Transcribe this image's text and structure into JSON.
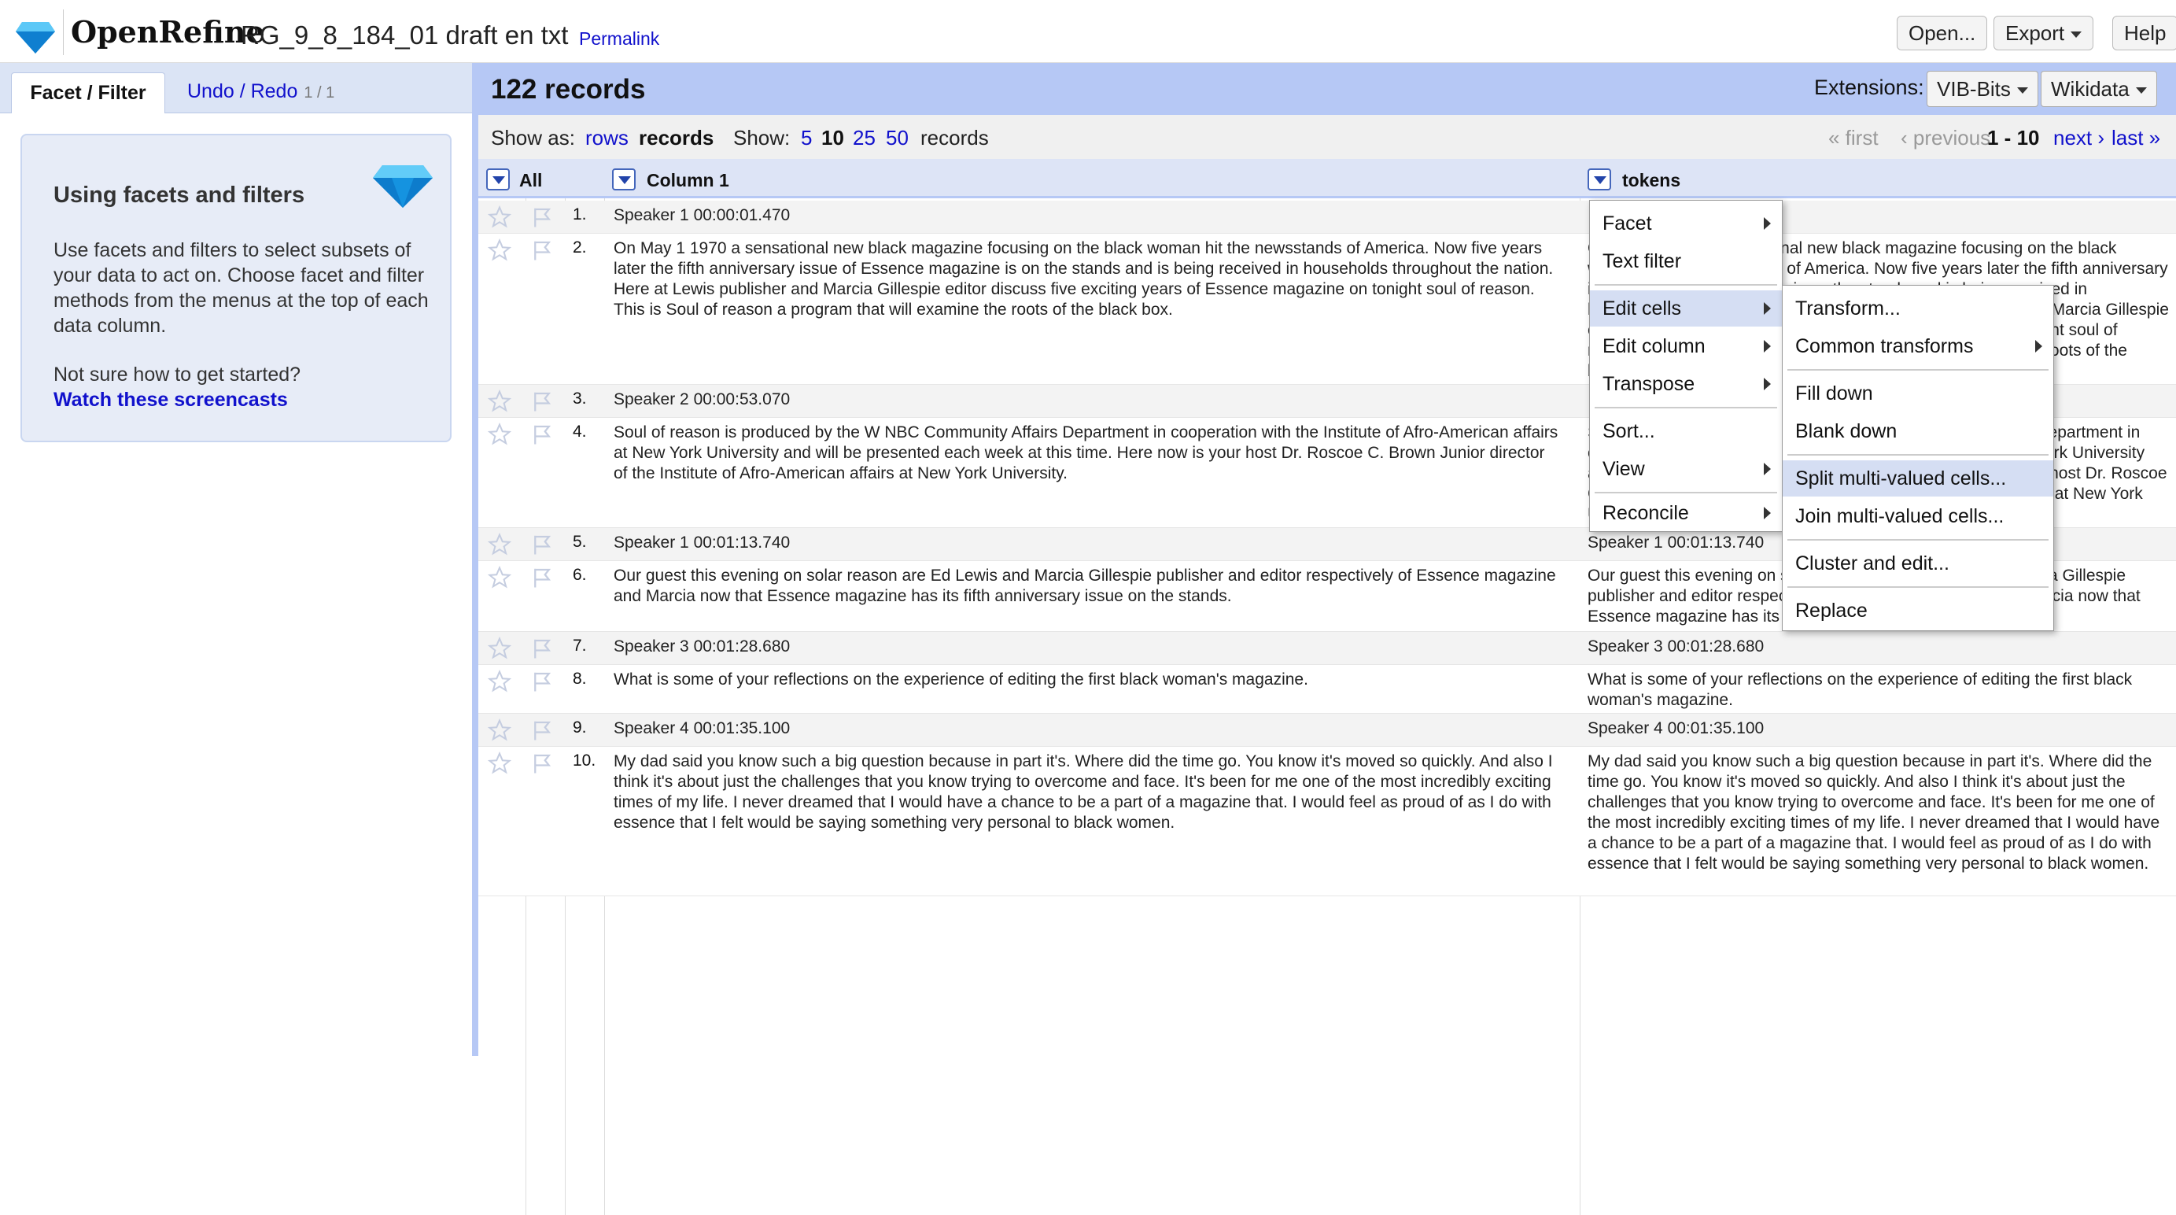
{
  "header": {
    "app_name": "OpenRefine",
    "project_name": "RG_9_8_184_01 draft en txt",
    "permalink": "Permalink",
    "open_label": "Open...",
    "export_label": "Export",
    "help_label": "Help"
  },
  "left_panel": {
    "tab_facet": "Facet / Filter",
    "tab_undo": "Undo / Redo",
    "tab_undo_count": "1 / 1",
    "help_title": "Using facets and filters",
    "help_body": "Use facets and filters to select subsets of your data to act on. Choose facet and filter methods from the menus at the top of each data column.",
    "help_started": "Not sure how to get started?",
    "help_link": "Watch these screencasts"
  },
  "summary": {
    "record_count": "122 records",
    "extensions_label": "Extensions:",
    "ext_vib": "VIB-Bits",
    "ext_wikidata": "Wikidata"
  },
  "view_bar": {
    "show_as": "Show as:",
    "rows": "rows",
    "records": "records",
    "show": "Show:",
    "sizes": [
      "5",
      "10",
      "25",
      "50"
    ],
    "records_suffix": "records",
    "first": "« first",
    "previous": "‹ previous",
    "range": "1 - 10",
    "next": "next ›",
    "last": "last »"
  },
  "columns": {
    "all": "All",
    "col1": "Column 1",
    "col2": "tokens"
  },
  "rows": [
    {
      "num": "1.",
      "c1": "Speaker 1 00:00:01.470",
      "c2": ""
    },
    {
      "num": "2.",
      "c1": "On May 1 1970 a sensational new black magazine focusing on the black woman hit the newsstands of America. Now five years later the fifth anniversary issue of Essence magazine is on the stands and is being received in households throughout the nation. Here at Lewis publisher and Marcia Gillespie editor discuss five exciting years of Essence magazine on tonight soul of reason. This is Soul of reason a program that will examine the roots of the black box.",
      "c2": "On May 1 1970 a sensational new black magazine focusing on the black woman hit the newsstands of America. Now five years later the fifth anniversary issue of Essence magazine is on the stands and is being received in households throughout the nation. Here at Lewis publisher and Marcia Gillespie editor discuss five exciting years of Essence magazine on tonight soul of reason. This is Soul of reason a program that will examine the roots of the black box."
    },
    {
      "num": "3.",
      "c1": "Speaker 2 00:00:53.070",
      "c2": ""
    },
    {
      "num": "4.",
      "c1": "Soul of reason is produced by the W NBC Community Affairs Department in cooperation with the Institute of Afro-American affairs at New York University and will be presented each week at this time. Here now is your host Dr. Roscoe C. Brown Junior director of the Institute of Afro-American affairs at New York University.",
      "c2": "Soul of reason is produced by the W NBC Community Affairs Department in cooperation with the Institute of Afro-American affairs at New York University and will be presented each week at this time. Here now is your host Dr. Roscoe C. Brown Junior director of the Institute of Afro-American affairs at New York University."
    },
    {
      "num": "5.",
      "c1": "Speaker 1 00:01:13.740",
      "c2": "Speaker 1 00:01:13.740"
    },
    {
      "num": "6.",
      "c1": "Our guest this evening on solar reason are Ed Lewis and Marcia Gillespie publisher and editor respectively of Essence magazine and Marcia now that Essence magazine has its fifth anniversary issue on the stands.",
      "c2": "Our guest this evening on solar reason are Ed Lewis and Marcia Gillespie publisher and editor respectively of Essence magazine and Marcia now that Essence magazine has its fifth anniversary issue on the stands."
    },
    {
      "num": "7.",
      "c1": "Speaker 3 00:01:28.680",
      "c2": "Speaker 3 00:01:28.680"
    },
    {
      "num": "8.",
      "c1": "What is some of your reflections on the experience of editing the first black woman's magazine.",
      "c2": "What is some of your reflections on the experience of editing the first black woman's magazine."
    },
    {
      "num": "9.",
      "c1": "Speaker 4 00:01:35.100",
      "c2": "Speaker 4 00:01:35.100"
    },
    {
      "num": "10.",
      "c1": "My dad said you know such a big question because in part it's. Where did the time go. You know it's moved so quickly. And also I think it's about just the challenges that you know trying to overcome and face. It's been for me one of the most incredibly exciting times of my life. I never dreamed that I would have a chance to be a part of a magazine that. I would feel as proud of as I do with essence that I felt would be saying something very personal to black women.",
      "c2": "My dad said you know such a big question because in part it's. Where did the time go. You know it's moved so quickly. And also I think it's about just the challenges that you know trying to overcome and face. It's been for me one of the most incredibly exciting times of my life. I never dreamed that I would have a chance to be a part of a magazine that. I would feel as proud of as I do with essence that I felt would be saying something very personal to black women."
    }
  ],
  "column_menu": {
    "facet": "Facet",
    "text_filter": "Text filter",
    "edit_cells": "Edit cells",
    "edit_column": "Edit column",
    "transpose": "Transpose",
    "sort": "Sort...",
    "view": "View",
    "reconcile": "Reconcile"
  },
  "edit_cells_menu": {
    "transform": "Transform...",
    "common_transforms": "Common transforms",
    "fill_down": "Fill down",
    "blank_down": "Blank down",
    "split": "Split multi-valued cells...",
    "join": "Join multi-valued cells...",
    "cluster": "Cluster and edit...",
    "replace": "Replace"
  },
  "colors": {
    "header_blue": "#b6c8f5",
    "link": "#11c",
    "menu_highlight": "#d5def3"
  }
}
